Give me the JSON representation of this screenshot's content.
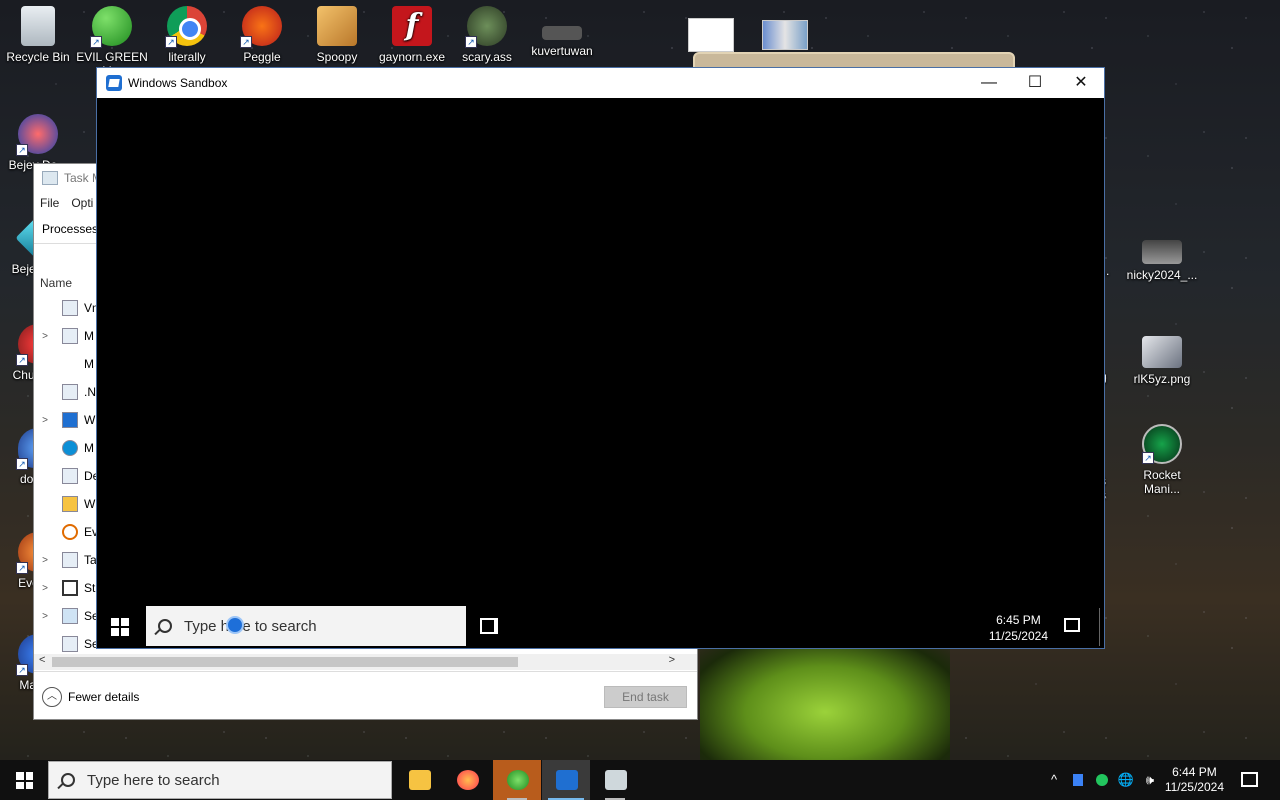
{
  "desktop": {
    "icons": [
      {
        "label": "Recycle Bin",
        "icon": "recycle-bin-icon"
      },
      {
        "label": "EVIL GREEN M...",
        "icon": "msn-messenger-icon"
      },
      {
        "label": "literally",
        "icon": "chrome-icon"
      },
      {
        "label": "Peggle",
        "icon": "peggle-icon"
      },
      {
        "label": "Spoopy",
        "icon": "folder-icon"
      },
      {
        "label": "gaynorn.exe",
        "icon": "flash-icon"
      },
      {
        "label": "scary.ass",
        "icon": "scary-icon"
      },
      {
        "label": "kuvertuwan",
        "icon": "file-icon"
      },
      {
        "label": "Bejev De...",
        "icon": "bejeweled-icon"
      },
      {
        "label": "Beje De...",
        "icon": "gem-icon"
      },
      {
        "label": "Chu De...",
        "icon": "cherry-icon"
      },
      {
        "label": "does...",
        "icon": "fire-icon"
      },
      {
        "label": "Every...",
        "icon": "everything-icon"
      },
      {
        "label": "Malw...",
        "icon": "malwarebytes-icon"
      },
      {
        "label": "nicky2024_...",
        "icon": "image-file-icon"
      },
      {
        "label": "rlK5yz.png",
        "icon": "png-file-icon"
      },
      {
        "label": "Rocket Mani...",
        "icon": "rocket-icon"
      },
      {
        "label": "ct...",
        "icon": "partial-icon"
      },
      {
        "label": "g",
        "icon": "partial-icon"
      },
      {
        "label": "s s",
        "icon": "partial-icon"
      }
    ]
  },
  "task_manager": {
    "title": "Task M",
    "menu": [
      "File",
      "Opti"
    ],
    "tab": "Processes",
    "column_name": "Name",
    "rows": [
      {
        "expand": "",
        "label": "Vm"
      },
      {
        "expand": ">",
        "label": "M"
      },
      {
        "expand": "",
        "label": "M"
      },
      {
        "expand": "",
        "label": ".N"
      },
      {
        "expand": ">",
        "label": "W"
      },
      {
        "expand": "",
        "label": "M"
      },
      {
        "expand": "",
        "label": "De"
      },
      {
        "expand": "",
        "label": "W"
      },
      {
        "expand": "",
        "label": "Ev"
      },
      {
        "expand": ">",
        "label": "Ta"
      },
      {
        "expand": ">",
        "label": "St"
      },
      {
        "expand": ">",
        "label": "Se"
      },
      {
        "expand": "",
        "label": "Se"
      }
    ],
    "scroll_left": "<",
    "scroll_right": ">",
    "fewer_details": "Fewer details",
    "end_task": "End task"
  },
  "sandbox": {
    "title": "Windows Sandbox",
    "minimize": "—",
    "maximize": "☐",
    "close": "✕",
    "search_placeholder": "Type here to search",
    "time": "6:45 PM",
    "date": "11/25/2024"
  },
  "taskbar": {
    "search_placeholder": "Type here to search",
    "apps": [
      {
        "name": "File Explorer",
        "icon": "file-explorer-icon",
        "color": "#f6c342"
      },
      {
        "name": "Firefox",
        "icon": "firefox-icon",
        "color": "#ff7139"
      },
      {
        "name": "MSN",
        "icon": "msn-icon",
        "color": "#4caf50"
      },
      {
        "name": "Windows Sandbox",
        "icon": "sandbox-icon",
        "color": "#1f6fd1"
      },
      {
        "name": "Task Manager",
        "icon": "task-manager-icon",
        "color": "#cfd8dc"
      }
    ],
    "tray": {
      "chevron": "^",
      "volume": "🕪",
      "network": "🌐"
    },
    "time": "6:44 PM",
    "date": "11/25/2024"
  }
}
